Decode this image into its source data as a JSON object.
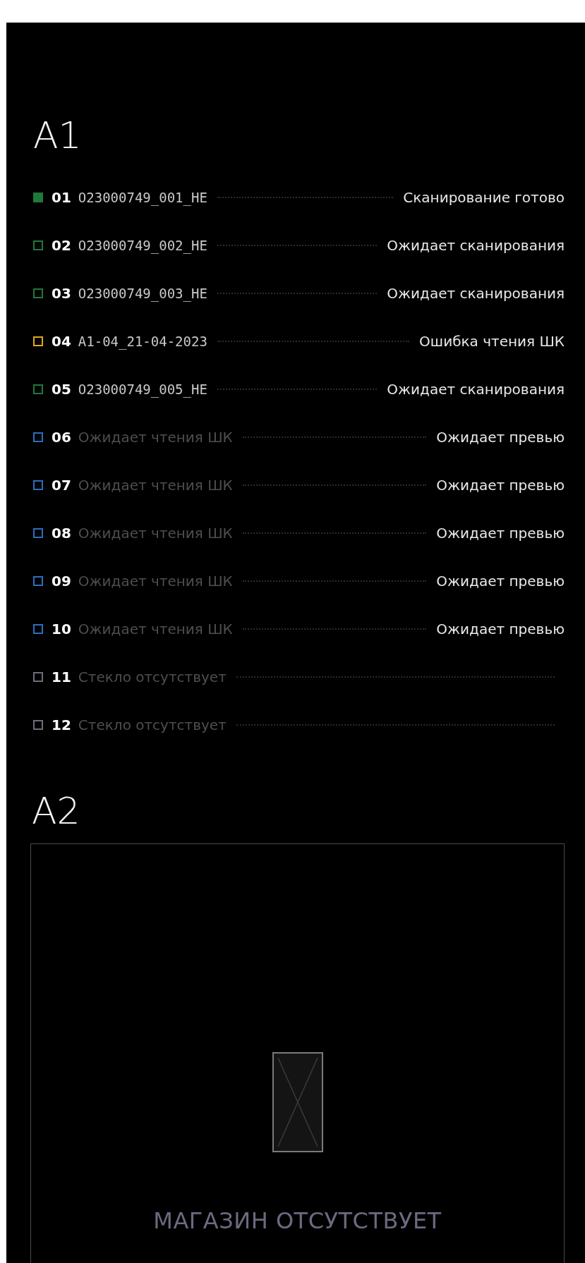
{
  "sections": [
    {
      "title": "A1",
      "slots": [
        {
          "number": "01",
          "kind": "code",
          "label": "O23000749_001_HE",
          "status": "Сканирование готово",
          "marker": {
            "filled": true,
            "color": "#1f7a3a"
          }
        },
        {
          "number": "02",
          "kind": "code",
          "label": "O23000749_002_HE",
          "status": "Ожидает сканирования",
          "marker": {
            "filled": false,
            "color": "#1f7a3a"
          }
        },
        {
          "number": "03",
          "kind": "code",
          "label": "O23000749_003_HE",
          "status": "Ожидает сканирования",
          "marker": {
            "filled": false,
            "color": "#1f7a3a"
          }
        },
        {
          "number": "04",
          "kind": "code",
          "label": "A1-04_21-04-2023",
          "status": "Ошибка чтения ШК",
          "marker": {
            "filled": false,
            "color": "#e0a81e"
          }
        },
        {
          "number": "05",
          "kind": "code",
          "label": "O23000749_005_HE",
          "status": "Ожидает сканирования",
          "marker": {
            "filled": false,
            "color": "#1f7a3a"
          }
        },
        {
          "number": "06",
          "kind": "message",
          "label": "Ожидает чтения ШК",
          "status": "Ожидает превью",
          "marker": {
            "filled": false,
            "color": "#2a6fc0"
          }
        },
        {
          "number": "07",
          "kind": "message",
          "label": "Ожидает чтения ШК",
          "status": "Ожидает превью",
          "marker": {
            "filled": false,
            "color": "#2a6fc0"
          }
        },
        {
          "number": "08",
          "kind": "message",
          "label": "Ожидает чтения ШК",
          "status": "Ожидает превью",
          "marker": {
            "filled": false,
            "color": "#2a6fc0"
          }
        },
        {
          "number": "09",
          "kind": "message",
          "label": "Ожидает чтения ШК",
          "status": "Ожидает превью",
          "marker": {
            "filled": false,
            "color": "#2a6fc0"
          }
        },
        {
          "number": "10",
          "kind": "message",
          "label": "Ожидает чтения ШК",
          "status": "Ожидает превью",
          "marker": {
            "filled": false,
            "color": "#2a6fc0"
          }
        },
        {
          "number": "11",
          "kind": "message",
          "label": "Стекло отсутствует",
          "marker": {
            "filled": false,
            "color": "#6e6c7c"
          }
        },
        {
          "number": "12",
          "kind": "message",
          "label": "Стекло отсутствует",
          "marker": {
            "filled": false,
            "color": "#6e6c7c"
          }
        }
      ]
    },
    {
      "title": "A2",
      "empty_message": "МАГАЗИН ОТСУТСТВУЕТ"
    }
  ]
}
